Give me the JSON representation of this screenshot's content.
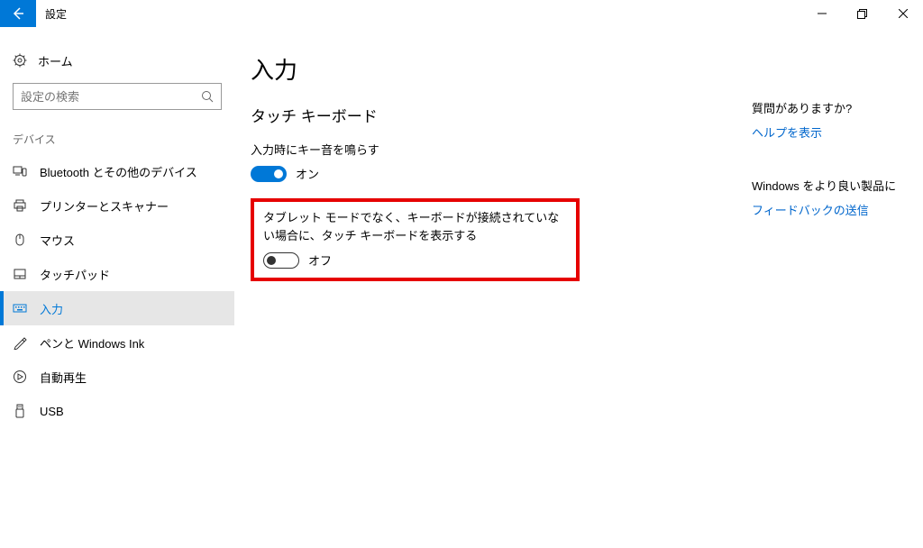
{
  "titlebar": {
    "title": "設定"
  },
  "sidebar": {
    "home_label": "ホーム",
    "search_placeholder": "設定の検索",
    "section_label": "デバイス",
    "items": [
      {
        "label": "Bluetooth とその他のデバイス"
      },
      {
        "label": "プリンターとスキャナー"
      },
      {
        "label": "マウス"
      },
      {
        "label": "タッチパッド"
      },
      {
        "label": "入力"
      },
      {
        "label": "ペンと Windows Ink"
      },
      {
        "label": "自動再生"
      },
      {
        "label": "USB"
      }
    ]
  },
  "content": {
    "page_title": "入力",
    "section_title": "タッチ キーボード",
    "setting1": {
      "label": "入力時にキー音を鳴らす",
      "state": "オン"
    },
    "setting2": {
      "label": "タブレット モードでなく、キーボードが接続されていない場合に、タッチ キーボードを表示する",
      "state": "オフ"
    }
  },
  "right": {
    "help_heading": "質問がありますか?",
    "help_link": "ヘルプを表示",
    "feedback_heading": "Windows をより良い製品に",
    "feedback_link": "フィードバックの送信"
  }
}
